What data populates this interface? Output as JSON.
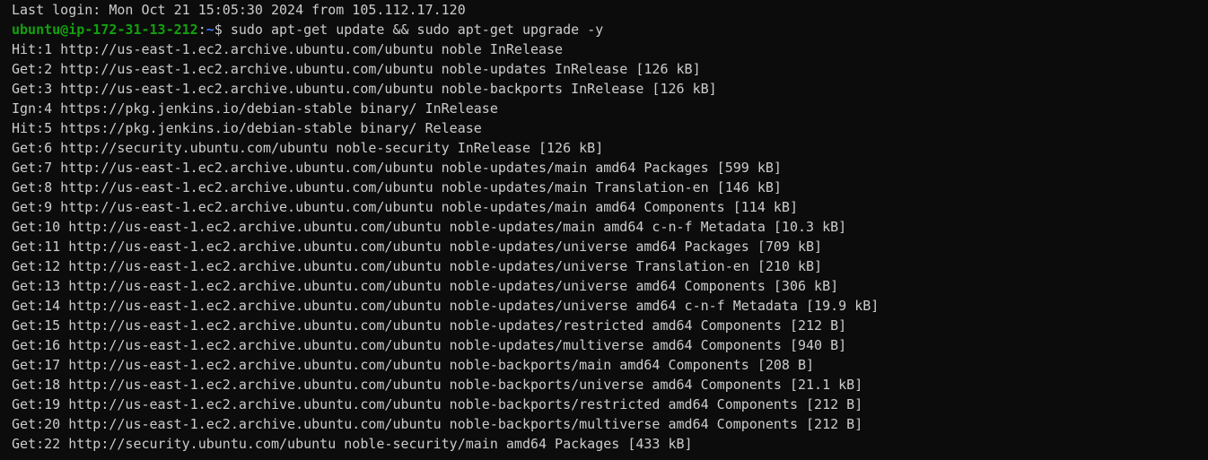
{
  "colors": {
    "background": "#0c0c0c",
    "foreground": "#cccccc",
    "prompt_user": "#13a10e",
    "prompt_path": "#3b78ff"
  },
  "terminal": {
    "last_login": "Last login: Mon Oct 21 15:05:30 2024 from 105.112.17.120",
    "prompt": {
      "user_host": "ubuntu@ip-172-31-13-212",
      "separator": ":",
      "path": "~",
      "symbol": "$ ",
      "command": "sudo apt-get update && sudo apt-get upgrade -y"
    },
    "output": [
      "Hit:1 http://us-east-1.ec2.archive.ubuntu.com/ubuntu noble InRelease",
      "Get:2 http://us-east-1.ec2.archive.ubuntu.com/ubuntu noble-updates InRelease [126 kB]",
      "Get:3 http://us-east-1.ec2.archive.ubuntu.com/ubuntu noble-backports InRelease [126 kB]",
      "Ign:4 https://pkg.jenkins.io/debian-stable binary/ InRelease",
      "Hit:5 https://pkg.jenkins.io/debian-stable binary/ Release",
      "Get:6 http://security.ubuntu.com/ubuntu noble-security InRelease [126 kB]",
      "Get:7 http://us-east-1.ec2.archive.ubuntu.com/ubuntu noble-updates/main amd64 Packages [599 kB]",
      "Get:8 http://us-east-1.ec2.archive.ubuntu.com/ubuntu noble-updates/main Translation-en [146 kB]",
      "Get:9 http://us-east-1.ec2.archive.ubuntu.com/ubuntu noble-updates/main amd64 Components [114 kB]",
      "Get:10 http://us-east-1.ec2.archive.ubuntu.com/ubuntu noble-updates/main amd64 c-n-f Metadata [10.3 kB]",
      "Get:11 http://us-east-1.ec2.archive.ubuntu.com/ubuntu noble-updates/universe amd64 Packages [709 kB]",
      "Get:12 http://us-east-1.ec2.archive.ubuntu.com/ubuntu noble-updates/universe Translation-en [210 kB]",
      "Get:13 http://us-east-1.ec2.archive.ubuntu.com/ubuntu noble-updates/universe amd64 Components [306 kB]",
      "Get:14 http://us-east-1.ec2.archive.ubuntu.com/ubuntu noble-updates/universe amd64 c-n-f Metadata [19.9 kB]",
      "Get:15 http://us-east-1.ec2.archive.ubuntu.com/ubuntu noble-updates/restricted amd64 Components [212 B]",
      "Get:16 http://us-east-1.ec2.archive.ubuntu.com/ubuntu noble-updates/multiverse amd64 Components [940 B]",
      "Get:17 http://us-east-1.ec2.archive.ubuntu.com/ubuntu noble-backports/main amd64 Components [208 B]",
      "Get:18 http://us-east-1.ec2.archive.ubuntu.com/ubuntu noble-backports/universe amd64 Components [21.1 kB]",
      "Get:19 http://us-east-1.ec2.archive.ubuntu.com/ubuntu noble-backports/restricted amd64 Components [212 B]",
      "Get:20 http://us-east-1.ec2.archive.ubuntu.com/ubuntu noble-backports/multiverse amd64 Components [212 B]",
      "Get:22 http://security.ubuntu.com/ubuntu noble-security/main amd64 Packages [433 kB]"
    ]
  }
}
